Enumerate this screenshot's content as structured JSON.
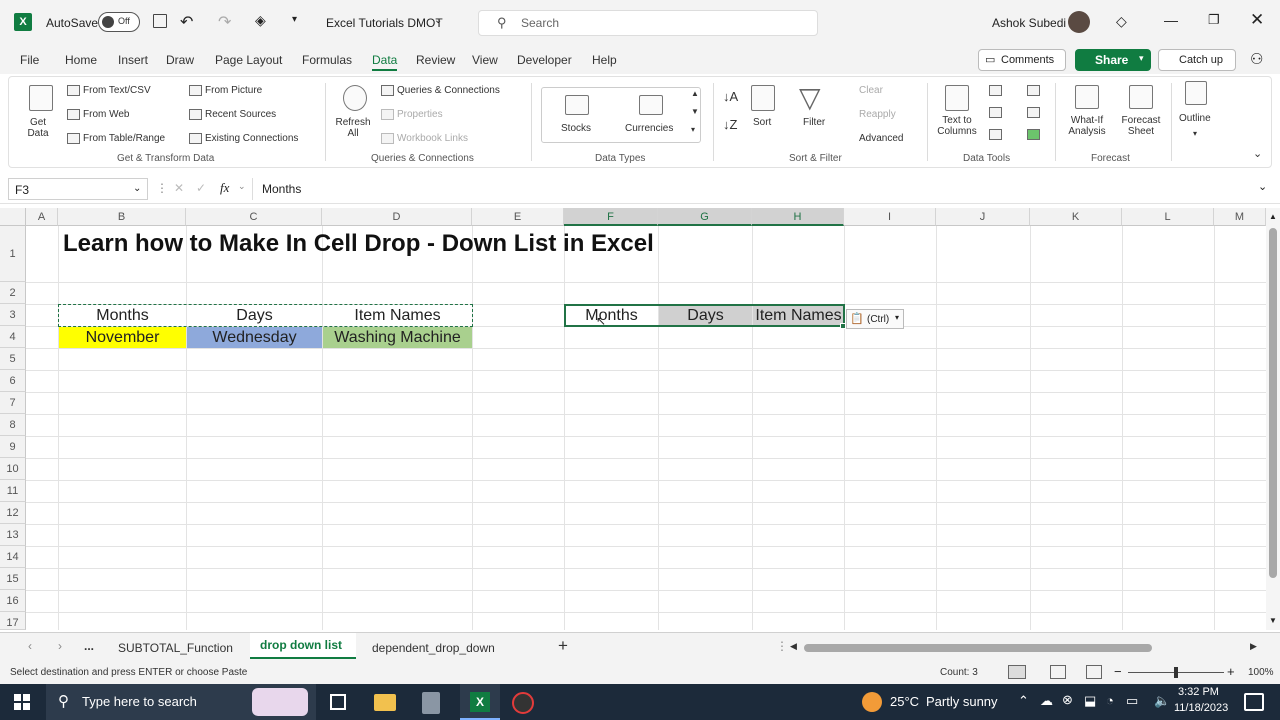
{
  "titlebar": {
    "autosave_label": "AutoSave",
    "autosave_state": "Off",
    "file_name": "Excel Tutorials DMOT",
    "search_placeholder": "Search",
    "user_name": "Ashok Subedi"
  },
  "menu": {
    "tabs": [
      "File",
      "Home",
      "Insert",
      "Draw",
      "Page Layout",
      "Formulas",
      "Data",
      "Review",
      "View",
      "Developer",
      "Help"
    ],
    "active": "Data",
    "comments": "Comments",
    "share": "Share",
    "catchup": "Catch up"
  },
  "ribbon": {
    "get_data": "Get Data",
    "from_text": "From Text/CSV",
    "from_web": "From Web",
    "from_table": "From Table/Range",
    "from_picture": "From Picture",
    "recent_sources": "Recent Sources",
    "existing_connections": "Existing Connections",
    "group_get_transform": "Get & Transform Data",
    "refresh_all": "Refresh All",
    "queries_connections": "Queries & Connections",
    "properties": "Properties",
    "workbook_links": "Workbook Links",
    "group_queries": "Queries & Connections",
    "stocks": "Stocks",
    "currencies": "Currencies",
    "group_data_types": "Data Types",
    "sort": "Sort",
    "filter": "Filter",
    "clear": "Clear",
    "reapply": "Reapply",
    "advanced": "Advanced",
    "group_sort_filter": "Sort & Filter",
    "text_to_columns": "Text to Columns",
    "group_data_tools": "Data Tools",
    "what_if": "What-If Analysis",
    "forecast_sheet": "Forecast Sheet",
    "group_forecast": "Forecast",
    "outline": "Outline"
  },
  "formula_bar": {
    "name_box": "F3",
    "fx": "fx",
    "content": "Months"
  },
  "grid": {
    "columns": [
      "A",
      "B",
      "C",
      "D",
      "E",
      "F",
      "G",
      "H",
      "I",
      "J",
      "K",
      "L",
      "M"
    ],
    "selected_columns": [
      "F",
      "G",
      "H"
    ],
    "rows": [
      "1",
      "2",
      "3",
      "4",
      "5",
      "6",
      "7",
      "8",
      "9",
      "10",
      "11",
      "12",
      "13",
      "14",
      "15",
      "16",
      "17"
    ],
    "title": "Learn how to Make In Cell Drop - Down List in Excel",
    "b3": "Months",
    "c3": "Days",
    "d3": "Item Names",
    "b4": "November",
    "c4": "Wednesday",
    "d4": "Washing Machine",
    "f3": "Months",
    "g3": "Days",
    "h3": "Item Names",
    "paste_options": "(Ctrl)",
    "colors": {
      "yellow": "#ffff00",
      "blue": "#8ea9db",
      "green": "#a9d08e",
      "gray": "#d0d0d0"
    }
  },
  "sheets": {
    "more": "...",
    "tabs": [
      "SUBTOTAL_Function",
      "drop down list",
      "dependent_drop_down"
    ],
    "active": "drop down list"
  },
  "status": {
    "message": "Select destination and press ENTER or choose Paste",
    "count": "Count: 3",
    "zoom": "100%"
  },
  "taskbar": {
    "search_placeholder": "Type here to search",
    "weather_temp": "25°C",
    "weather_desc": "Partly sunny",
    "time": "3:32 PM",
    "date": "11/18/2023"
  }
}
